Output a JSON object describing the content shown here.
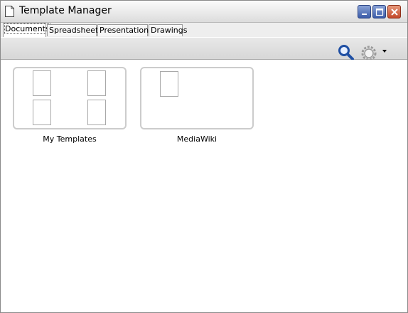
{
  "window": {
    "title": "Template Manager"
  },
  "tabs": [
    {
      "label": "Documents",
      "active": true
    },
    {
      "label": "Spreadsheets",
      "active": false
    },
    {
      "label": "Presentations",
      "active": false
    },
    {
      "label": "Drawings",
      "active": false
    }
  ],
  "toolbar": {
    "icons": [
      "search-icon",
      "gear-icon",
      "dropdown-arrow-icon"
    ]
  },
  "folders": [
    {
      "label": "My Templates",
      "thumbnails": 4
    },
    {
      "label": "MediaWiki",
      "thumbnails": 1
    }
  ],
  "colors": {
    "accent": "#1f4fa3",
    "folder_border": "#cccccc"
  }
}
